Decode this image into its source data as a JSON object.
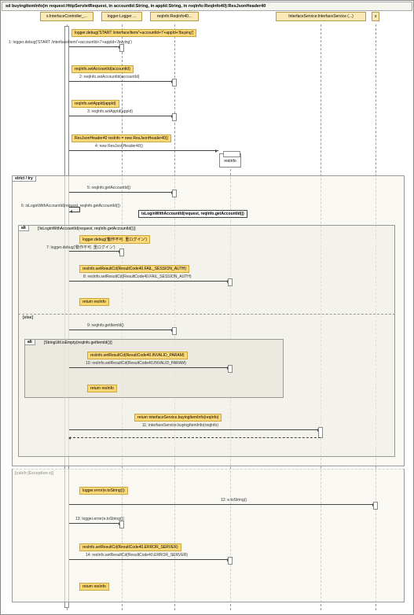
{
  "title": "sd buyingItemInfo(in request:HttpServletRequest, in accountId:String, in appId:String, in reqInfo:ReqInfo40):ResJsonHeader40",
  "participants": {
    "controller": "s:InterfaceController_...",
    "logger": "logger:Logger ...",
    "reqinfo": "reqInfo:ReqInfo40...",
    "service": "InterfaceService:InterfaceService (...)",
    "extra": "s"
  },
  "messages": {
    "m1_note": "logger.debug('START /interface/item/'+accountId+'/'+appId+'/buying')",
    "m1": "1: logger.debug('START /interface/item/'+accountId+'/'+appId+'/buying')",
    "m2_note": "reqInfo.setAccountId(accountId)",
    "m2": "2: reqInfo.setAccountId(accountId)",
    "m3_note": "reqInfo.setAppId(appId)",
    "m3": "3: reqInfo.setAppId(appId)",
    "m4_note": "ResJsonHeader40 resInfo = new ResJsonHeader40()",
    "m4": "4: new ResJsonHeader40()",
    "obj": "resInfo",
    "m5": "5: reqInfo.getAccountId()",
    "m6": "6: isLoginWithAccountId(request, reqInfo.getAccountId())",
    "m6_box": "isLoginWithAccountId(request, reqInfo.getAccountId())",
    "alt1_cond": "[!isLoginWithAccountId(request, reqInfo.getAccountId())]",
    "m7_note": "logger.debug('動作不可. 重ログイン')",
    "m7": "7: logger.debug('動作不可. 重ログイン')",
    "m8_note": "resInfo.setResultCd(ResultCode40.FAIL_SESSION_AUTH)",
    "m8": "8: resInfo.setResultCd(ResultCode40.FAIL_SESSION_AUTH)",
    "ret1": "return resInfo",
    "else_label": "[else]",
    "m9": "9: reqInfo.getItemId()",
    "alt2_cond": "[StringUtil.isEmpty(reqInfo.getItemId())]",
    "m10_note": "resInfo.setResultCd(ResultCode40.INVALID_PARAM)",
    "m10": "10: resInfo.setResultCd(ResultCode40.INVALID_PARAM)",
    "ret2": "return resInfo",
    "m11_note": "return interfaceService.buyingItemInfo(reqInfo)",
    "m11": "11: interfaceService.buyingItemInfo(reqInfo)",
    "catch_label": "[catch (Exception e)]",
    "m12_note": "logger.error(e.toString())",
    "m12": "12: e.toString()",
    "m13": "13: logger.error(e.toString())",
    "m14_note": "resInfo.setResultCd(ResultCode40.ERROR_SERVER)",
    "m14": "14: resInfo.setResultCd(ResultCode40.ERROR_SERVER)",
    "ret3": "return resInfo"
  },
  "frags": {
    "try": "strict / try",
    "alt": "alt",
    "alt2": "alt"
  },
  "chart_data": {
    "type": "sequence-diagram",
    "participants": [
      "s:InterfaceController",
      "logger:Logger",
      "reqInfo:ReqInfo40",
      "InterfaceService:InterfaceService",
      "s"
    ],
    "interactions": [
      {
        "n": 1,
        "from": "controller",
        "to": "logger",
        "label": "logger.debug('START /interface/item/'+accountId+'/'+appId+'/buying')"
      },
      {
        "n": 2,
        "from": "controller",
        "to": "reqinfo",
        "label": "reqInfo.setAccountId(accountId)"
      },
      {
        "n": 3,
        "from": "controller",
        "to": "reqinfo",
        "label": "reqInfo.setAppId(appId)"
      },
      {
        "n": 4,
        "from": "controller",
        "to": "create",
        "label": "new ResJsonHeader40()",
        "creates": "resInfo"
      },
      {
        "fragment": "strict/try",
        "children": [
          {
            "n": 5,
            "from": "controller",
            "to": "reqinfo",
            "label": "reqInfo.getAccountId()"
          },
          {
            "n": 6,
            "from": "controller",
            "to": "controller",
            "label": "isLoginWithAccountId(request, reqInfo.getAccountId())"
          },
          {
            "fragment": "alt",
            "guard": "!isLoginWithAccountId(request, reqInfo.getAccountId())",
            "children": [
              {
                "n": 7,
                "from": "controller",
                "to": "logger",
                "label": "logger.debug('動作不可. 重ログイン')"
              },
              {
                "n": 8,
                "from": "controller",
                "to": "resInfo",
                "label": "resInfo.setResultCd(ResultCode40.FAIL_SESSION_AUTH)"
              },
              {
                "return": "return resInfo"
              }
            ],
            "else": [
              {
                "n": 9,
                "from": "controller",
                "to": "reqinfo",
                "label": "reqInfo.getItemId()"
              },
              {
                "fragment": "alt",
                "guard": "StringUtil.isEmpty(reqInfo.getItemId())",
                "children": [
                  {
                    "n": 10,
                    "from": "controller",
                    "to": "resInfo",
                    "label": "resInfo.setResultCd(ResultCode40.INVALID_PARAM)"
                  },
                  {
                    "return": "return resInfo"
                  }
                ]
              },
              {
                "n": 11,
                "from": "controller",
                "to": "service",
                "label": "interfaceService.buyingItemInfo(reqInfo)",
                "return": true
              }
            ]
          }
        ],
        "catch": [
          {
            "n": 12,
            "from": "controller",
            "to": "exception",
            "label": "e.toString()"
          },
          {
            "n": 13,
            "from": "controller",
            "to": "logger",
            "label": "logger.error(e.toString())"
          },
          {
            "n": 14,
            "from": "controller",
            "to": "resInfo",
            "label": "resInfo.setResultCd(ResultCode40.ERROR_SERVER)"
          },
          {
            "return": "return resInfo"
          }
        ]
      }
    ]
  }
}
